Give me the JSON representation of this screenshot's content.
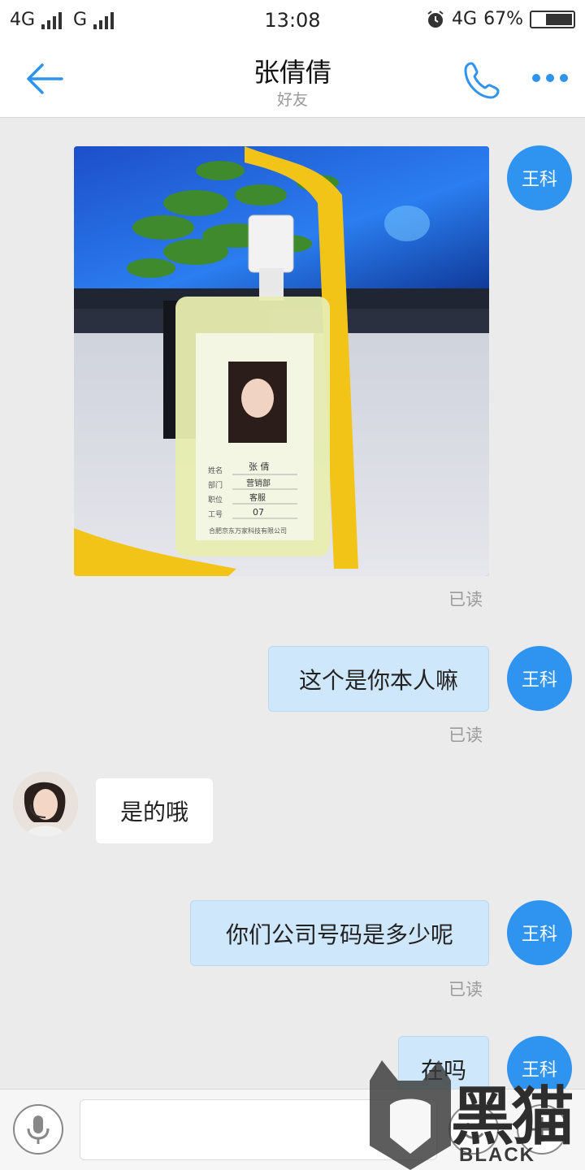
{
  "status_bar": {
    "network_1": "4G",
    "network_2": "G",
    "time": "13:08",
    "network_3": "4G",
    "battery": "67%"
  },
  "header": {
    "title": "张倩倩",
    "subtitle": "好友"
  },
  "icons": {
    "back": "back-arrow-icon",
    "call": "phone-icon",
    "more": "more-dots-icon",
    "mic": "microphone-icon",
    "emoji": "emoji-icon",
    "plus": "plus-icon"
  },
  "colors": {
    "accent": "#2f93f0",
    "my_bubble": "#cfe7fb",
    "background": "#ebebeb"
  },
  "messages": [
    {
      "sender": "me",
      "avatar_label": "王科",
      "type": "image",
      "image_text": {
        "label_name": "姓名",
        "name": "张 倩",
        "label_dept": "部门",
        "dept": "营销部",
        "label_position": "职位",
        "position": "客服",
        "label_id": "工号",
        "id": "07",
        "company": "合肥京东万家科技有限公司"
      },
      "status": "已读"
    },
    {
      "sender": "me",
      "avatar_label": "王科",
      "type": "text",
      "text": "这个是你本人嘛",
      "status": "已读"
    },
    {
      "sender": "other",
      "type": "text",
      "text": "是的哦"
    },
    {
      "sender": "me",
      "avatar_label": "王科",
      "type": "text",
      "text": "你们公司号码是多少呢",
      "status": "已读"
    },
    {
      "sender": "me",
      "avatar_label": "王科",
      "type": "text",
      "text": "在吗"
    }
  ],
  "watermark": {
    "chars": "黑猫",
    "text": "BLACK CAT"
  }
}
